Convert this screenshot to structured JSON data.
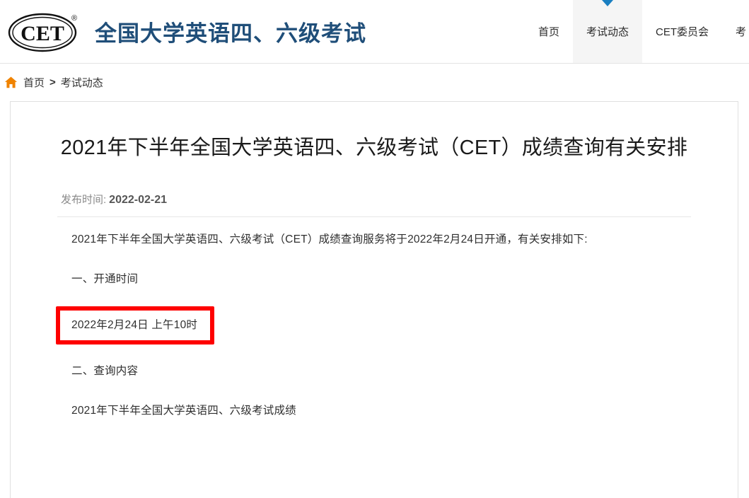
{
  "header": {
    "logo_alt": "CET",
    "logo_mark_text": "CET",
    "logo_trademark": "®",
    "brand_title": "全国大学英语四、六级考试",
    "brand_color": "#1f4e79",
    "nav": [
      {
        "label": "首页",
        "active": false
      },
      {
        "label": "考试动态",
        "active": true
      },
      {
        "label": "CET委员会",
        "active": false
      },
      {
        "label": "考",
        "active": false
      }
    ],
    "active_marker_color": "#1a7fc1",
    "active_tab_bg": "#f5f5f5"
  },
  "breadcrumb": {
    "home_icon": "home-icon",
    "home_icon_color": "#f08300",
    "items": [
      "首页",
      "考试动态"
    ],
    "separator": ">"
  },
  "article": {
    "title": "2021年下半年全国大学英语四、六级考试（CET）成绩查询有关安排",
    "publish_label": "发布时间:",
    "publish_date": "2022-02-21",
    "paragraphs": [
      "2021年下半年全国大学英语四、六级考试（CET）成绩查询服务将于2022年2月24日开通，有关安排如下:",
      "一、开通时间",
      "2022年2月24日 上午10时",
      "二、查询内容",
      "2021年下半年全国大学英语四、六级考试成绩"
    ],
    "highlight": {
      "text": "2022年2月24日 上午10时",
      "border_color": "#fe0000"
    }
  }
}
